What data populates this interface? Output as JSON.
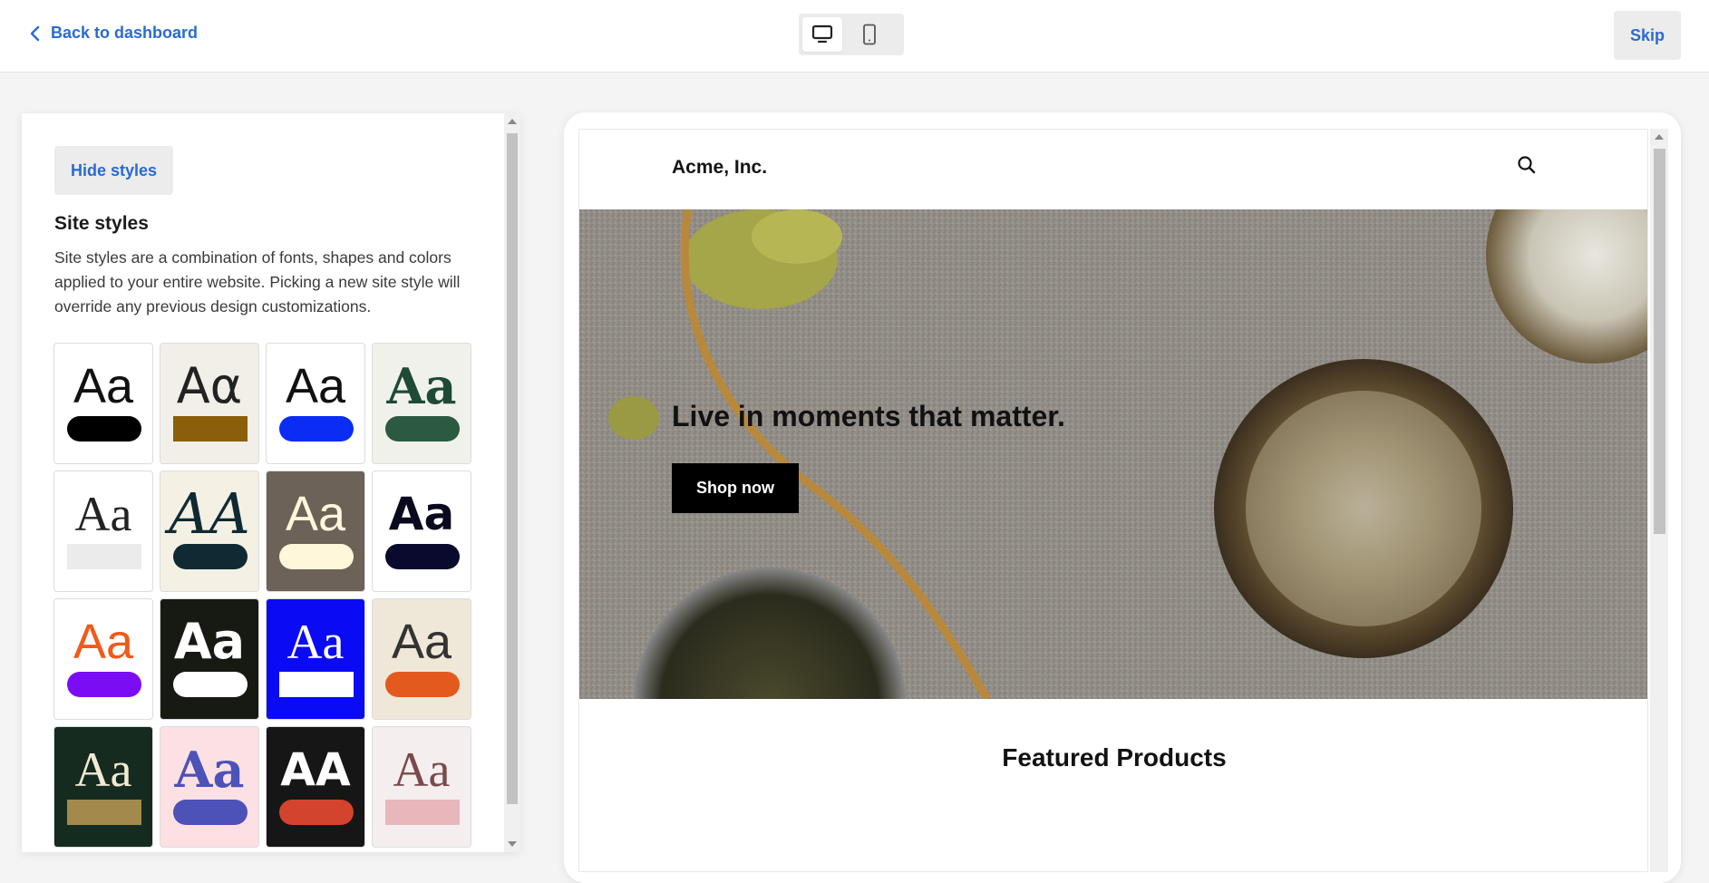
{
  "topbar": {
    "back_label": "Back to dashboard",
    "skip_label": "Skip",
    "device_modes": [
      "desktop",
      "mobile"
    ],
    "active_device": "desktop"
  },
  "panel": {
    "hide_label": "Hide styles",
    "title": "Site styles",
    "description": "Site styles are a combination of fonts, shapes and colors applied to your entire website. Picking a new site style will override any previous design customizations.",
    "tiles_label": "Aa",
    "tiles": [
      {
        "bg": "#ffffff",
        "fg": "#111111",
        "bar": "#000000",
        "shape": "pill",
        "font": "sans",
        "text": "Aa"
      },
      {
        "bg": "#f1efe8",
        "fg": "#222222",
        "bar": "#8b5e0a",
        "shape": "rect",
        "font": "sans-light",
        "text": "Aα"
      },
      {
        "bg": "#ffffff",
        "fg": "#111111",
        "bar": "#0a2cf5",
        "shape": "pill",
        "font": "sans",
        "text": "Aa"
      },
      {
        "bg": "#f1f1ec",
        "fg": "#1f4a36",
        "bar": "#2c5a41",
        "shape": "pill",
        "font": "serif-bold",
        "text": "Aa"
      },
      {
        "bg": "#ffffff",
        "fg": "#222222",
        "bar": "#ebebeb",
        "shape": "rect",
        "font": "serif",
        "text": "Aa"
      },
      {
        "bg": "#f4f0e3",
        "fg": "#0f2a33",
        "bar": "#0f2a33",
        "shape": "pill",
        "font": "script",
        "text": "AA"
      },
      {
        "bg": "#6c6258",
        "fg": "#fff7d9",
        "bar": "#fff7d9",
        "shape": "pill",
        "font": "sans",
        "text": "Aa"
      },
      {
        "bg": "#ffffff",
        "fg": "#0a0a1f",
        "bar": "#0a0a2e",
        "shape": "pill",
        "font": "display",
        "text": "Aa"
      },
      {
        "bg": "#ffffff",
        "fg": "#f05a1a",
        "bar": "#7b0df5",
        "shape": "pill",
        "font": "sans",
        "text": "Aa"
      },
      {
        "bg": "#171a12",
        "fg": "#ffffff",
        "bar": "#ffffff",
        "shape": "pill",
        "font": "sans-bold",
        "text": "Aa"
      },
      {
        "bg": "#0a0af5",
        "fg": "#ffffff",
        "bar": "#ffffff",
        "shape": "rect",
        "font": "serif",
        "text": "Aa"
      },
      {
        "bg": "#efe8d8",
        "fg": "#333333",
        "bar": "#e45a1e",
        "shape": "pill",
        "font": "sans",
        "text": "Aa"
      },
      {
        "bg": "#152b1f",
        "fg": "#f2ead3",
        "bar": "#a38a4c",
        "shape": "rect",
        "font": "serif",
        "text": "Aa"
      },
      {
        "bg": "#fde0e4",
        "fg": "#4c52b8",
        "bar": "#4c52b8",
        "shape": "pill",
        "font": "serif-bold",
        "text": "Aa"
      },
      {
        "bg": "#161616",
        "fg": "#ffffff",
        "bar": "#d3432e",
        "shape": "pill",
        "font": "display",
        "text": "AA"
      },
      {
        "bg": "#f5eeee",
        "fg": "#7a4a4a",
        "bar": "#e8b7bb",
        "shape": "rect",
        "font": "serif-light",
        "text": "Aa"
      }
    ]
  },
  "preview": {
    "brand": "Acme, Inc.",
    "hero_title": "Live in moments that matter.",
    "cta_label": "Shop now",
    "section_title": "Featured Products"
  },
  "colors": {
    "accent": "#2a6bd0",
    "button_bg": "#ececed"
  }
}
